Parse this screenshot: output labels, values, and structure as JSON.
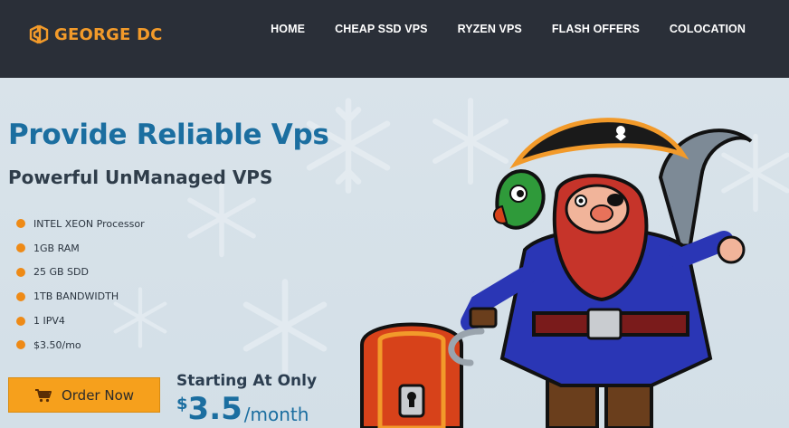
{
  "header": {
    "logo_text": "GEORGE DC",
    "nav": [
      {
        "label": "HOME"
      },
      {
        "label": "CHEAP SSD VPS"
      },
      {
        "label": "RYZEN VPS"
      },
      {
        "label": "FLASH OFFERS"
      },
      {
        "label": "COLOCATION"
      }
    ]
  },
  "hero": {
    "title": "Provide Reliable Vps",
    "subtitle": "Powerful UnManaged VPS",
    "features": [
      "INTEL XEON Processor",
      "1GB RAM",
      "25 GB SDD",
      "1TB BANDWIDTH",
      "1 IPV4",
      "$3.50/mo"
    ],
    "order_button": "Order Now",
    "starting_label": "Starting At Only",
    "price": {
      "currency": "$",
      "amount": "3.5",
      "period": "/month"
    }
  },
  "icons": [
    "logo-mark-icon",
    "cart-icon",
    "snowflake-icon",
    "pirate-illustration"
  ],
  "colors": {
    "header_bg": "#2a2f38",
    "accent": "#f29a2a",
    "title": "#1b6ea0",
    "hero_bg": "#d7e2ea"
  }
}
